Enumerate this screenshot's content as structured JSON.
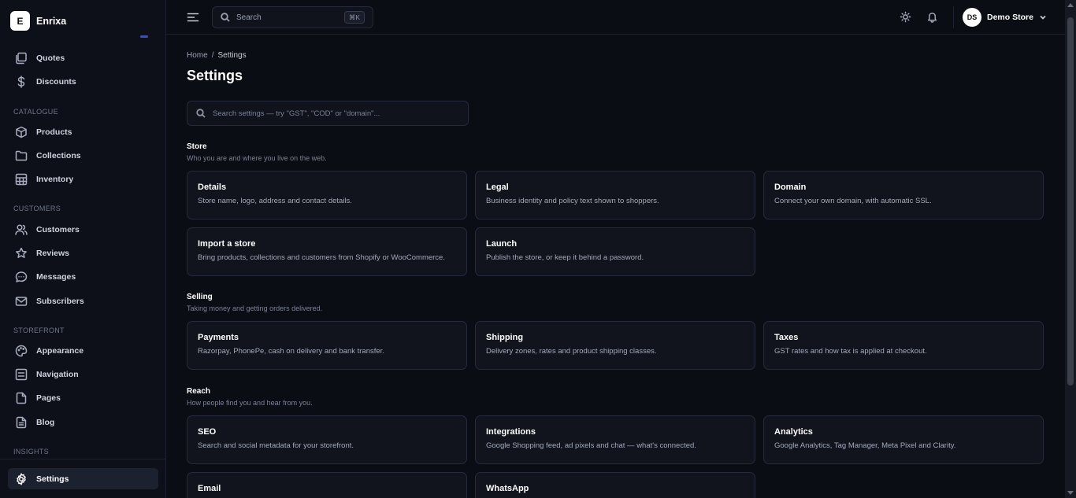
{
  "app": {
    "logo_letter": "E",
    "name": "Enrixa"
  },
  "sidebar": {
    "top_items": [
      {
        "label": "Quotes",
        "icon": "quotes-icon"
      },
      {
        "label": "Discounts",
        "icon": "dollar-icon"
      }
    ],
    "sections": [
      {
        "label": "CATALOGUE",
        "items": [
          {
            "label": "Products",
            "icon": "box-icon"
          },
          {
            "label": "Collections",
            "icon": "folder-icon"
          },
          {
            "label": "Inventory",
            "icon": "grid-icon"
          }
        ]
      },
      {
        "label": "CUSTOMERS",
        "items": [
          {
            "label": "Customers",
            "icon": "users-icon"
          },
          {
            "label": "Reviews",
            "icon": "star-icon"
          },
          {
            "label": "Messages",
            "icon": "message-icon"
          },
          {
            "label": "Subscribers",
            "icon": "mail-icon"
          }
        ]
      },
      {
        "label": "STOREFRONT",
        "items": [
          {
            "label": "Appearance",
            "icon": "palette-icon"
          },
          {
            "label": "Navigation",
            "icon": "navigation-icon"
          },
          {
            "label": "Pages",
            "icon": "page-icon"
          },
          {
            "label": "Blog",
            "icon": "blog-icon"
          }
        ]
      }
    ],
    "cut_section": "INSIGHTS",
    "active": {
      "label": "Settings",
      "icon": "gear-icon"
    }
  },
  "topbar": {
    "search_placeholder": "Search",
    "shortcut": "⌘K",
    "account_initials": "DS",
    "store_name": "Demo Store"
  },
  "breadcrumb": {
    "home": "Home",
    "separator": "/",
    "current": "Settings"
  },
  "page_title": "Settings",
  "settings_search_placeholder": "Search settings — try \"GST\", \"COD\" or \"domain\"...",
  "groups": [
    {
      "title": "Store",
      "subtitle": "Who you are and where you live on the web.",
      "cards": [
        {
          "title": "Details",
          "desc": "Store name, logo, address and contact details."
        },
        {
          "title": "Legal",
          "desc": "Business identity and policy text shown to shoppers."
        },
        {
          "title": "Domain",
          "desc": "Connect your own domain, with automatic SSL."
        },
        {
          "title": "Import a store",
          "desc": "Bring products, collections and customers from Shopify or WooCommerce."
        },
        {
          "title": "Launch",
          "desc": "Publish the store, or keep it behind a password."
        }
      ]
    },
    {
      "title": "Selling",
      "subtitle": "Taking money and getting orders delivered.",
      "cards": [
        {
          "title": "Payments",
          "desc": "Razorpay, PhonePe, cash on delivery and bank transfer."
        },
        {
          "title": "Shipping",
          "desc": "Delivery zones, rates and product shipping classes."
        },
        {
          "title": "Taxes",
          "desc": "GST rates and how tax is applied at checkout."
        }
      ]
    },
    {
      "title": "Reach",
      "subtitle": "How people find you and hear from you.",
      "cards": [
        {
          "title": "SEO",
          "desc": "Search and social metadata for your storefront."
        },
        {
          "title": "Integrations",
          "desc": "Google Shopping feed, ad pixels and chat — what's connected."
        },
        {
          "title": "Analytics",
          "desc": "Google Analytics, Tag Manager, Meta Pixel and Clarity."
        },
        {
          "title": "Email",
          "desc": ""
        },
        {
          "title": "WhatsApp",
          "desc": ""
        }
      ]
    }
  ]
}
